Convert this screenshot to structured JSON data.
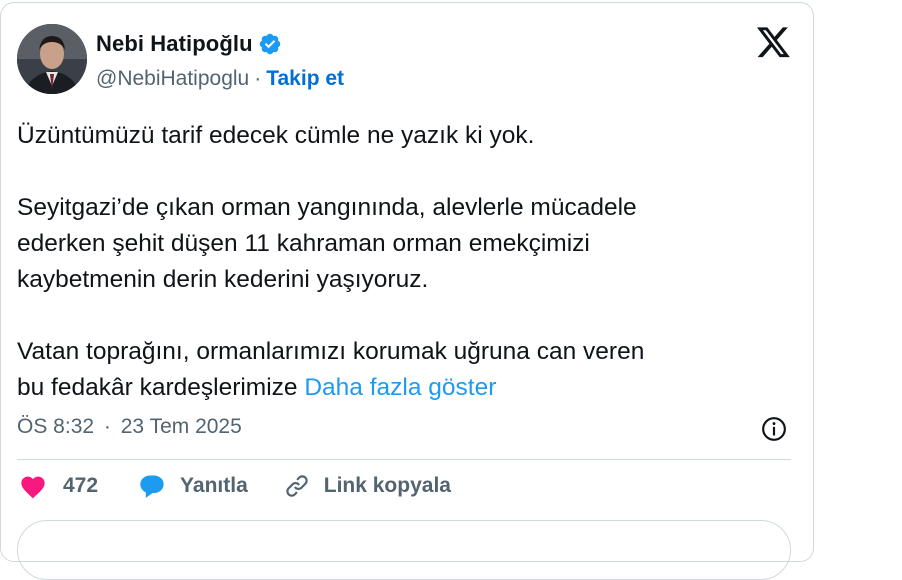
{
  "author": {
    "name": "Nebi Hatipoğlu",
    "handle": "@NebiHatipoglu",
    "separator": "·",
    "follow_label": "Takip et",
    "verified": true
  },
  "platform_icon": "x-logo-icon",
  "tweet": {
    "paragraphs": [
      [
        "Üzüntümüzü tarif edecek cümle ne yazık ki yok."
      ],
      [
        "Seyitgazi’de çıkan orman yangınında, alevlerle mücadele",
        "ederken şehit düşen 11 kahraman  orman emekçimizi",
        "kaybetmenin derin kederini yaşıyoruz."
      ],
      [
        "Vatan toprağını, ormanlarımızı korumak uğruna can veren",
        "bu fedakâr kardeşlerimize "
      ]
    ],
    "show_more_label": "Daha fazla göster"
  },
  "meta": {
    "time": "ÖS 8:32",
    "separator": "·",
    "date": "23 Tem 2025"
  },
  "actions": {
    "like_count": "472",
    "reply_label": "Yanıtla",
    "copy_link_label": "Link kopyala"
  },
  "colors": {
    "link": "#1d9bf0",
    "follow": "#006fd6",
    "like": "#f91880",
    "verified": "#1d9bf0",
    "muted": "#536471"
  }
}
